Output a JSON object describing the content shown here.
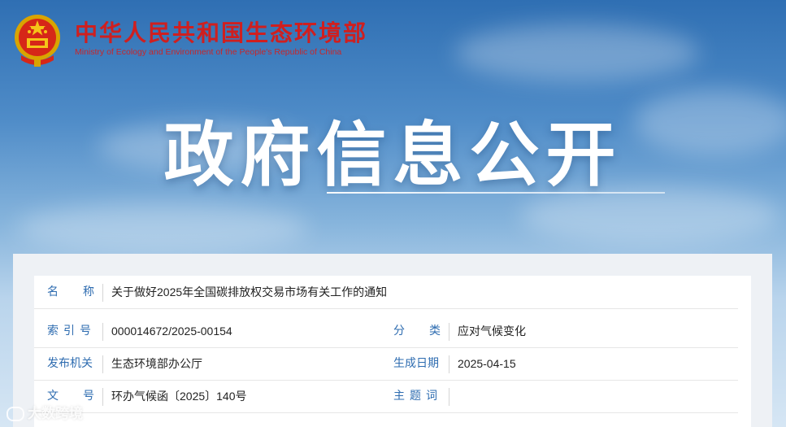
{
  "header": {
    "ministry_cn": "中华人民共和国生态环境部",
    "ministry_en": "Ministry of Ecology and Environment of the People's Republic of China",
    "emblem_icon": "national-emblem-icon"
  },
  "banner": {
    "title": "政府信息公开"
  },
  "info": {
    "name_label": "名　称",
    "name_value": "关于做好2025年全国碳排放权交易市场有关工作的通知",
    "index_label": "索引号",
    "index_value": "000014672/2025-00154",
    "category_label": "分　类",
    "category_value": "应对气候变化",
    "issuer_label": "发布机关",
    "issuer_value": "生态环境部办公厅",
    "date_label": "生成日期",
    "date_value": "2025-04-15",
    "docno_label": "文　号",
    "docno_value": "环办气候函〔2025〕140号",
    "keywords_label": "主题词",
    "keywords_value": ""
  },
  "watermark": {
    "text": "大数跨境"
  },
  "colors": {
    "brand_red": "#cf1f1f",
    "label_blue": "#2e6cb0",
    "sky": "#4f8cc8"
  }
}
